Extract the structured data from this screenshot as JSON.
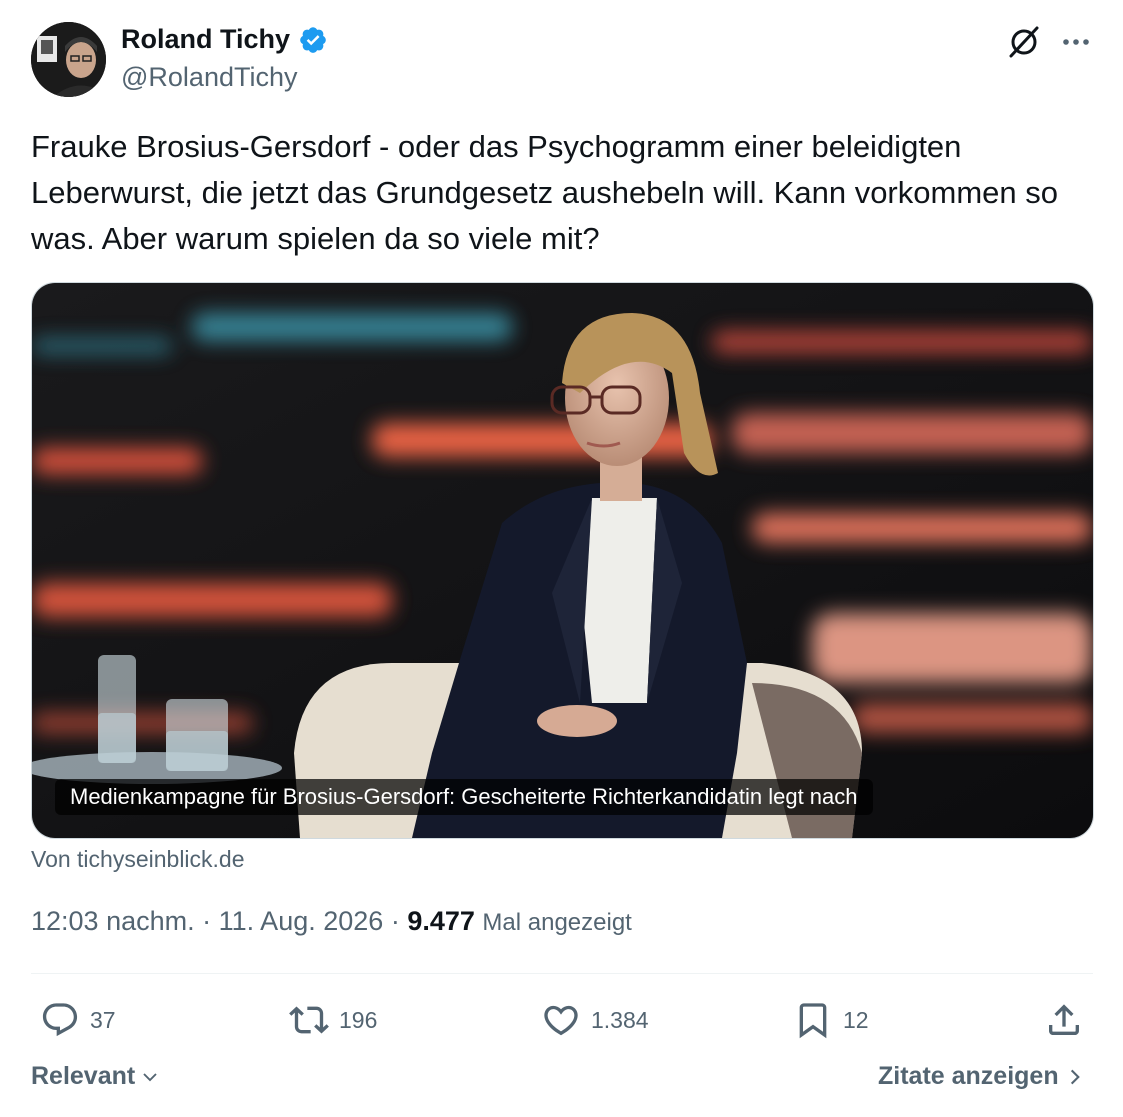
{
  "author": {
    "name": "Roland Tichy",
    "handle": "@RolandTichy"
  },
  "icons": {
    "verified": "verified-badge-icon",
    "grok": "grok-icon",
    "more": "more-icon",
    "reply": "reply-icon",
    "retweet": "retweet-icon",
    "like": "heart-icon",
    "bookmark": "bookmark-icon",
    "share": "share-icon"
  },
  "colors": {
    "verified": "#1d9bf0",
    "secondary_text": "#536471",
    "primary_text": "#0f1419"
  },
  "tweet": {
    "text": "Frauke Brosius-Gersdorf - oder das Psychogramm einer beleidigten Leberwurst, die jetzt das Grundgesetz aushebeln will. Kann vorkommen so was. Aber warum spielen da so viele mit?"
  },
  "card": {
    "title": "Medienkampagne für Brosius-Gersdorf: Gescheiterte Richterkandidatin legt nach",
    "source": "Von tichyseinblick.de"
  },
  "meta": {
    "time": "12:03 nachm.",
    "separator": "·",
    "date": "11. Aug. 2026",
    "views_count": "9.477",
    "views_label": "Mal angezeigt"
  },
  "actions": {
    "replies": "37",
    "retweets": "196",
    "likes": "1.384",
    "bookmarks": "12"
  },
  "footer": {
    "sort_label": "Relevant",
    "quotes_label": "Zitate anzeigen"
  }
}
